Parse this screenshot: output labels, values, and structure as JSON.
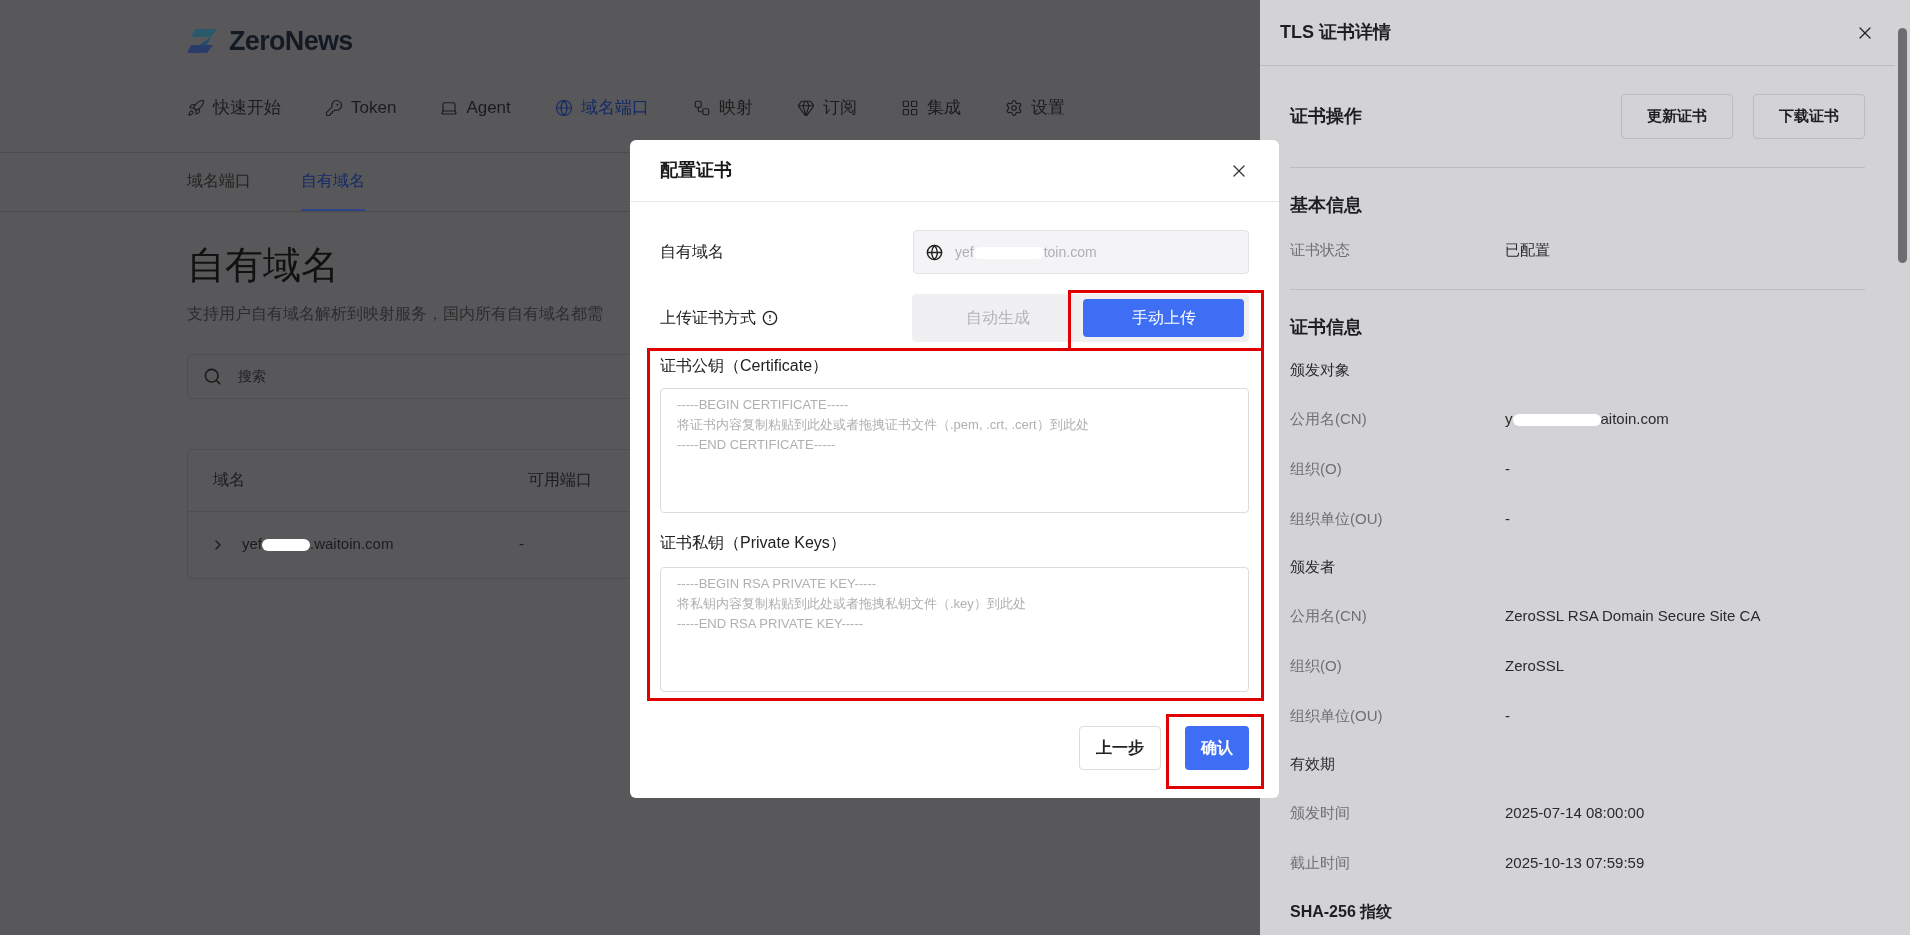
{
  "logo": {
    "text": "ZeroNews"
  },
  "nav": [
    {
      "label": "快速开始",
      "selected": false
    },
    {
      "label": "Token",
      "selected": false
    },
    {
      "label": "Agent",
      "selected": false
    },
    {
      "label": "域名端口",
      "selected": true
    },
    {
      "label": "映射",
      "selected": false
    },
    {
      "label": "订阅",
      "selected": false
    },
    {
      "label": "集成",
      "selected": false
    },
    {
      "label": "设置",
      "selected": false
    }
  ],
  "sub_tabs": [
    {
      "label": "域名端口",
      "selected": false
    },
    {
      "label": "自有域名",
      "selected": true
    }
  ],
  "page": {
    "title": "自有域名",
    "subtitle": "支持用户自有域名解析到映射服务，国内所有自有域名都需",
    "search": {
      "placeholder": "搜索"
    }
  },
  "table": {
    "columns": [
      "域名",
      "可用端口"
    ],
    "rows": [
      {
        "domain_start": "yef",
        "domain_end": ".waitoin.com",
        "port": "-",
        "expanded": false
      }
    ]
  },
  "modal": {
    "title": "配置证书",
    "domain_label": "自有域名",
    "domain_start": "yef",
    "domain_end": "toin.com",
    "method_label": "上传证书方式",
    "methods": [
      {
        "label": "自动生成",
        "selected": false
      },
      {
        "label": "手动上传",
        "selected": true
      }
    ],
    "cert_label": "证书公钥（Certificate）",
    "cert_placeholder": "-----BEGIN CERTIFICATE-----\n将证书内容复制粘贴到此处或者拖拽证书文件（.pem, .crt, .cert）到此处\n-----END CERTIFICATE-----",
    "key_label": "证书私钥（Private Keys）",
    "key_placeholder": "-----BEGIN RSA PRIVATE KEY-----\n将私钥内容复制粘贴到此处或者拖拽私钥文件（.key）到此处\n-----END RSA PRIVATE KEY-----",
    "buttons": [
      {
        "label": "上一步",
        "kind": "secondary"
      },
      {
        "label": "确认",
        "kind": "primary"
      }
    ]
  },
  "drawer": {
    "title": "TLS 证书详情",
    "actions_title": "证书操作",
    "actions": [
      "更新证书",
      "下载证书"
    ],
    "sections": [
      {
        "title": "基本信息",
        "rows": [
          {
            "kind": "field",
            "label": "证书状态",
            "value": "已配置"
          }
        ]
      },
      {
        "title": "证书信息",
        "rows": [
          {
            "kind": "group",
            "label": "颁发对象"
          },
          {
            "kind": "redacted",
            "label": "公用名(CN)",
            "value_start": "y",
            "value_end": "aitoin.com"
          },
          {
            "kind": "field",
            "label": "组织(O)",
            "value": "-"
          },
          {
            "kind": "field",
            "label": "组织单位(OU)",
            "value": "-"
          },
          {
            "kind": "group",
            "label": "颁发者"
          },
          {
            "kind": "field",
            "label": "公用名(CN)",
            "value": "ZeroSSL RSA Domain Secure Site CA"
          },
          {
            "kind": "field",
            "label": "组织(O)",
            "value": "ZeroSSL"
          },
          {
            "kind": "field",
            "label": "组织单位(OU)",
            "value": "-"
          },
          {
            "kind": "group",
            "label": "有效期"
          },
          {
            "kind": "field",
            "label": "颁发时间",
            "value": "2025-07-14 08:00:00"
          },
          {
            "kind": "field",
            "label": "截止时间",
            "value": "2025-10-13 07:59:59"
          },
          {
            "kind": "heading",
            "label": "SHA-256 指纹"
          }
        ]
      }
    ]
  }
}
